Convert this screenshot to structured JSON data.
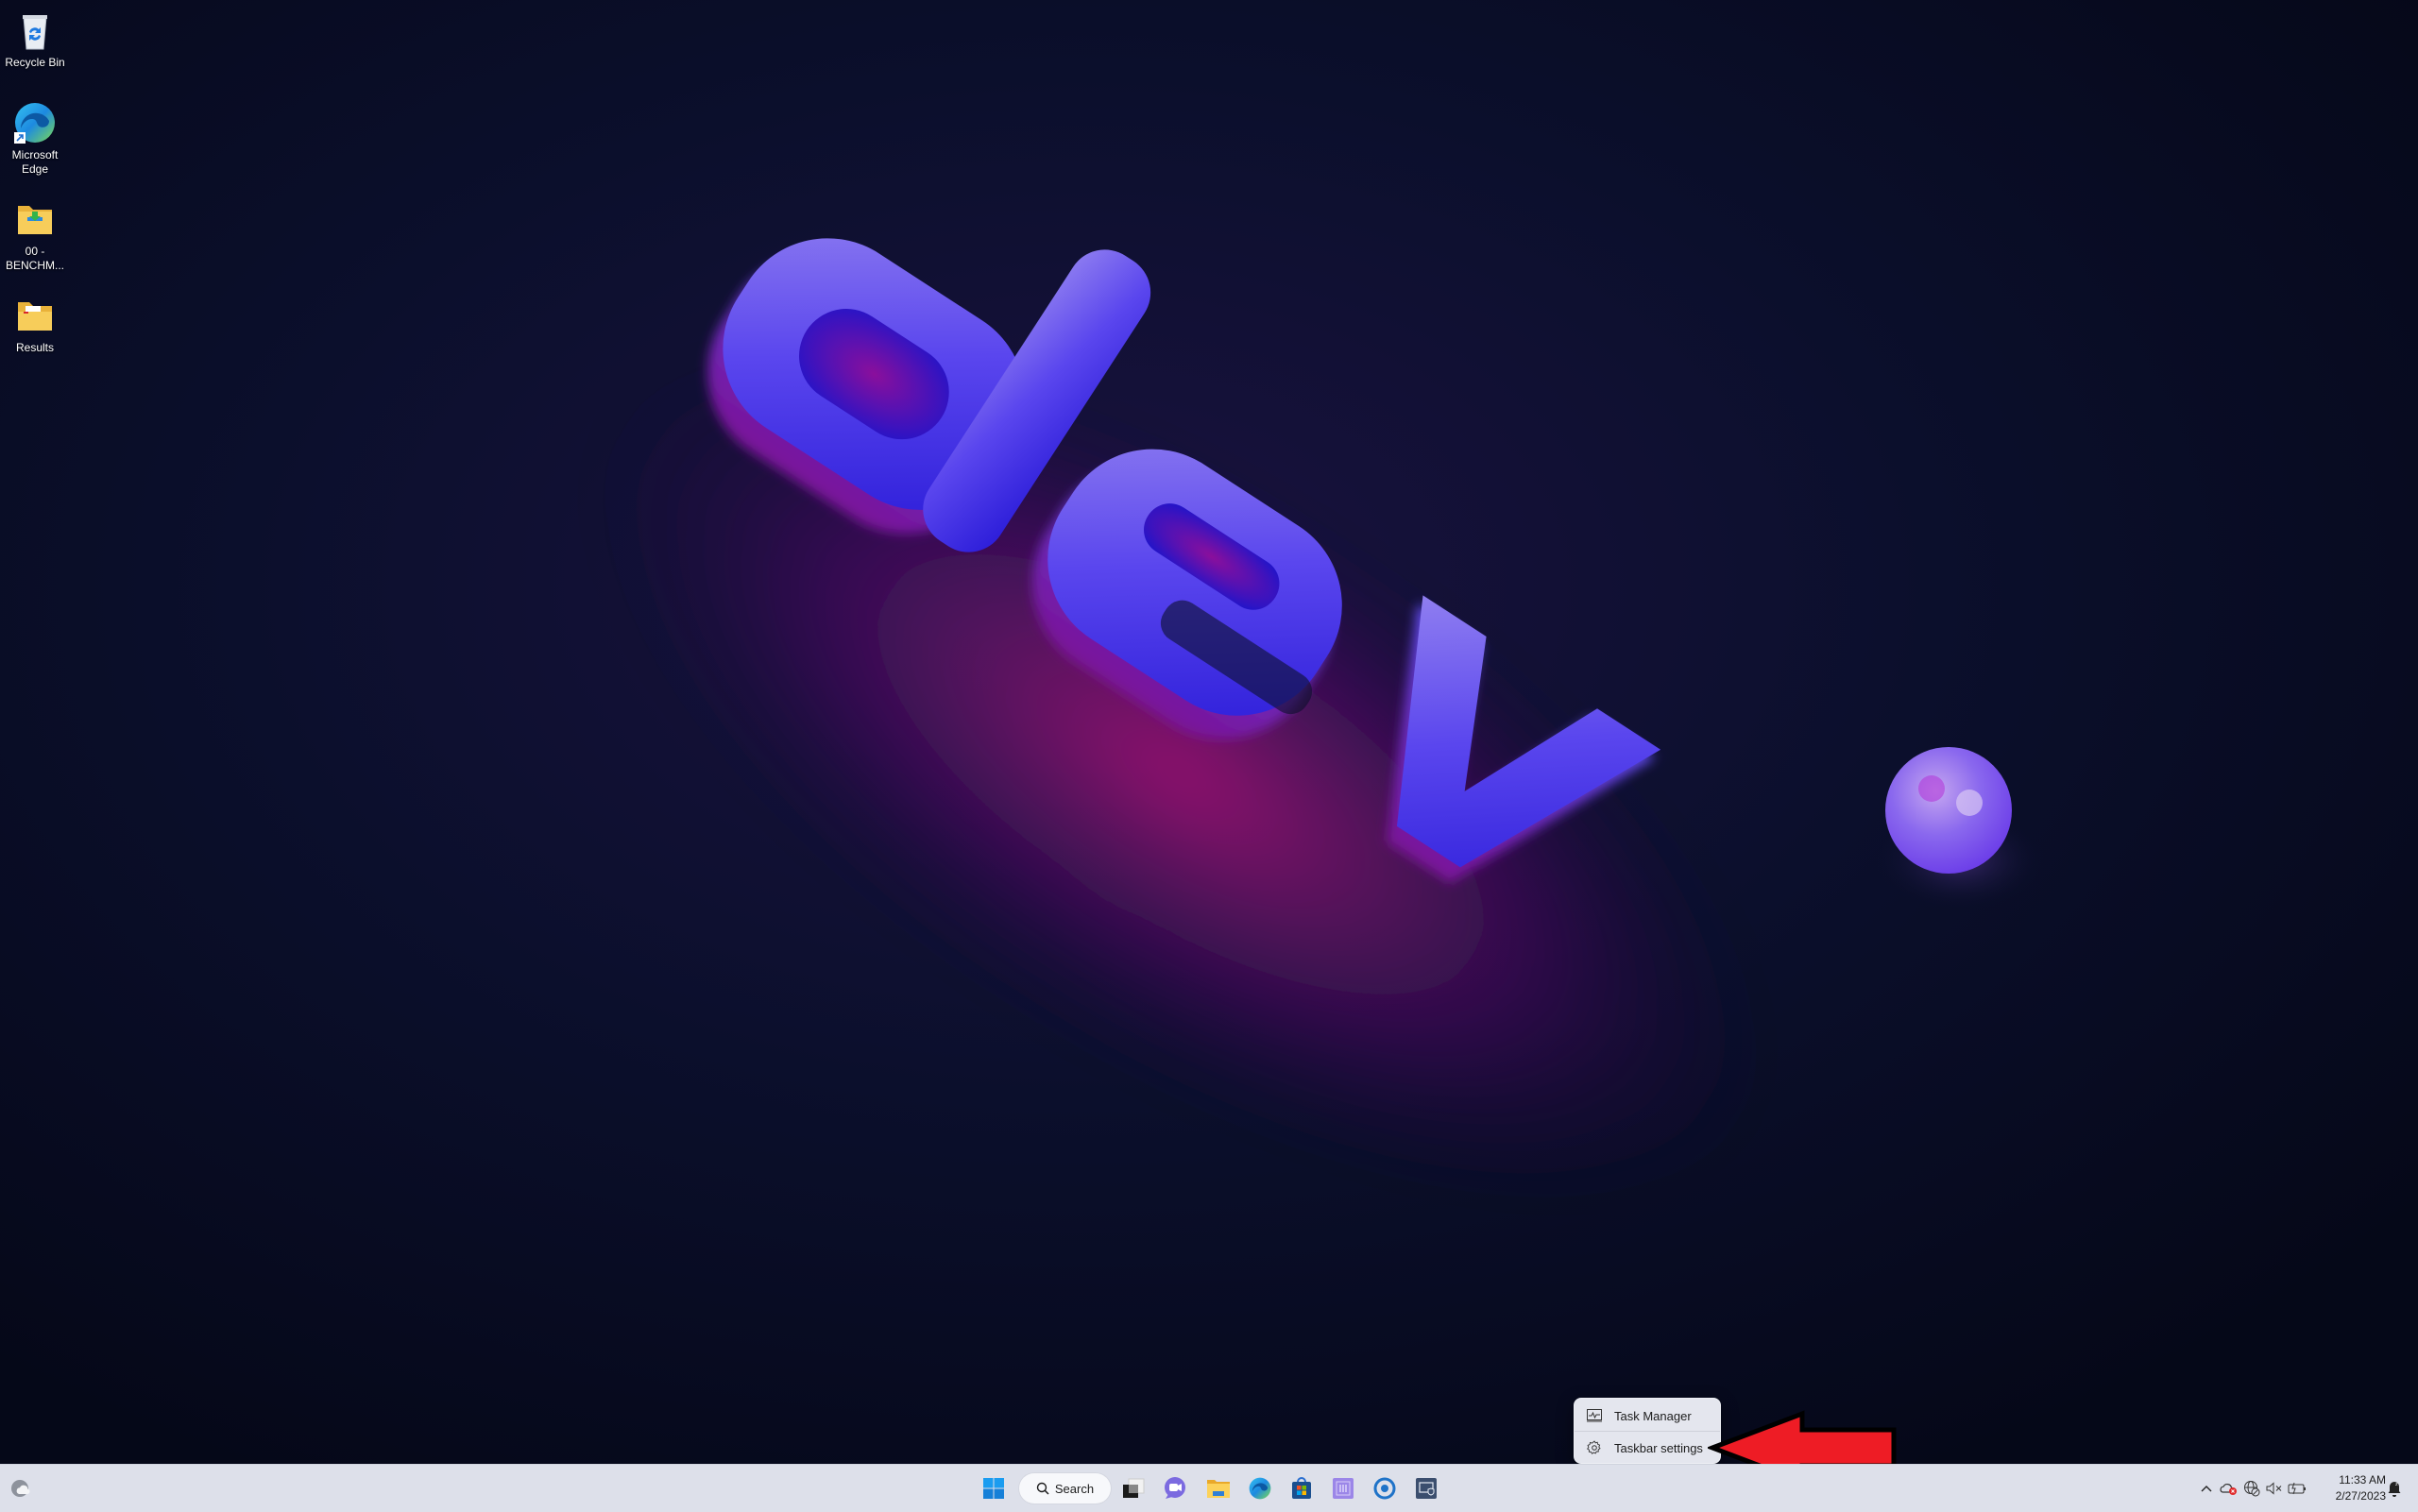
{
  "desktop": {
    "icons": [
      {
        "label": "Recycle Bin",
        "icon": "recycle-bin-icon"
      },
      {
        "label": "Microsoft Edge",
        "icon": "edge-icon"
      },
      {
        "label": "00 - BENCHM...",
        "icon": "folder-icon"
      },
      {
        "label": "Results",
        "icon": "folder-icon"
      }
    ],
    "wallpaper": {
      "text": "dev.",
      "colors": {
        "bg": "#070b1f",
        "accent": "#5a3cf0",
        "glow": "#c0197a"
      }
    }
  },
  "context_menu": {
    "items": [
      {
        "label": "Task Manager",
        "icon": "task-manager-icon"
      },
      {
        "label": "Taskbar settings",
        "icon": "gear-icon"
      }
    ]
  },
  "annotation": {
    "type": "arrow",
    "color": "#ee1c25",
    "points_to": "Taskbar settings"
  },
  "taskbar": {
    "widgets_icon": "weather-icon",
    "start_icon": "windows-start-icon",
    "search": {
      "label": "Search"
    },
    "pinned": [
      {
        "name": "Task View",
        "icon": "task-view-icon"
      },
      {
        "name": "Chat",
        "icon": "teams-chat-icon"
      },
      {
        "name": "File Explorer",
        "icon": "file-explorer-icon"
      },
      {
        "name": "Microsoft Edge",
        "icon": "edge-icon"
      },
      {
        "name": "Microsoft Store",
        "icon": "store-icon"
      },
      {
        "name": "App",
        "icon": "purple-app-icon"
      },
      {
        "name": "App",
        "icon": "circle-app-icon"
      },
      {
        "name": "App",
        "icon": "remote-security-icon"
      }
    ],
    "tray": {
      "icons": [
        "chevron-up-icon",
        "onedrive-error-icon",
        "network-no-internet-icon",
        "volume-muted-icon",
        "battery-charging-icon"
      ],
      "time": "11:33 AM",
      "date": "2/27/2023",
      "notification_icon": "focus-bell-icon"
    }
  }
}
